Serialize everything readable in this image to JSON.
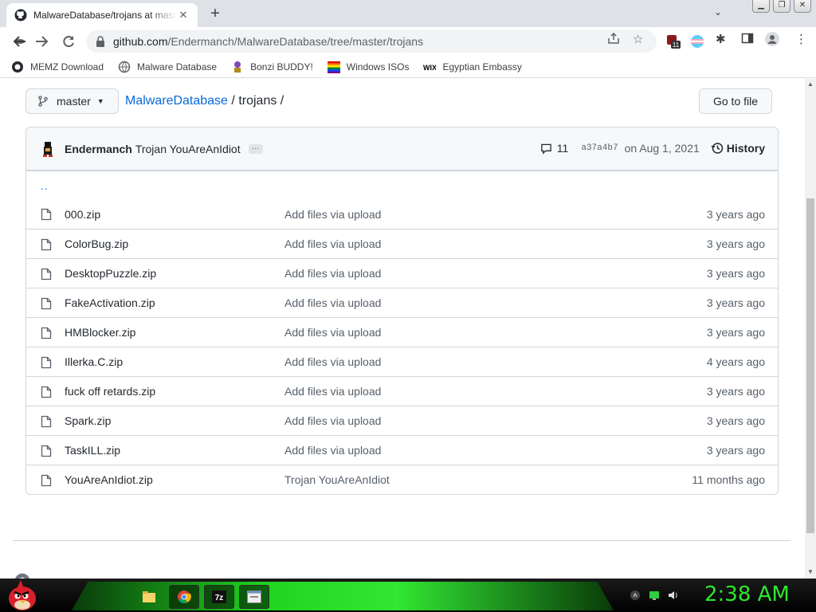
{
  "browser": {
    "tab_title": "MalwareDatabase/trojans at master",
    "url_host": "github.com",
    "url_path": "/Endermanch/MalwareDatabase/tree/master/trojans",
    "extension_badge": "11"
  },
  "bookmarks": [
    {
      "label": "MEMZ Download",
      "icon": "github-icon"
    },
    {
      "label": "Malware Database",
      "icon": "globe-icon"
    },
    {
      "label": "Bonzi BUDDY!",
      "icon": "bonzi-icon"
    },
    {
      "label": "Windows ISOs",
      "icon": "windows-flag-icon"
    },
    {
      "label": "Egyptian Embassy",
      "icon": "wix-icon"
    }
  ],
  "repo": {
    "branch": "master",
    "repo_name": "MalwareDatabase",
    "folder": "trojans",
    "separator": "/",
    "go_to_file": "Go to file"
  },
  "commit": {
    "author": "Endermanch",
    "message": "Trojan YouAreAnIdiot",
    "ellipsis": "…",
    "comments": "11",
    "sha": "a37a4b7",
    "date": "on Aug 1, 2021",
    "history": "History"
  },
  "parent_dir": "..",
  "files": [
    {
      "name": "000.zip",
      "message": "Add files via upload",
      "age": "3 years ago"
    },
    {
      "name": "ColorBug.zip",
      "message": "Add files via upload",
      "age": "3 years ago"
    },
    {
      "name": "DesktopPuzzle.zip",
      "message": "Add files via upload",
      "age": "3 years ago"
    },
    {
      "name": "FakeActivation.zip",
      "message": "Add files via upload",
      "age": "3 years ago"
    },
    {
      "name": "HMBlocker.zip",
      "message": "Add files via upload",
      "age": "3 years ago"
    },
    {
      "name": "Illerka.C.zip",
      "message": "Add files via upload",
      "age": "4 years ago"
    },
    {
      "name": "fuck off retards.zip",
      "message": "Add files via upload",
      "age": "3 years ago"
    },
    {
      "name": "Spark.zip",
      "message": "Add files via upload",
      "age": "3 years ago"
    },
    {
      "name": "TaskILL.zip",
      "message": "Add files via upload",
      "age": "3 years ago"
    },
    {
      "name": "YouAreAnIdiot.zip",
      "message": "Trojan YouAreAnIdiot",
      "age": "11 months ago"
    }
  ],
  "taskbar": {
    "clock": "2:38 AM",
    "apps": [
      "file-explorer-icon",
      "chrome-icon",
      "7zip-icon",
      "window-app-icon"
    ]
  },
  "colors": {
    "link": "#0969da",
    "clock": "#2ee62e",
    "taskbar_glow": "#1fd41f"
  }
}
